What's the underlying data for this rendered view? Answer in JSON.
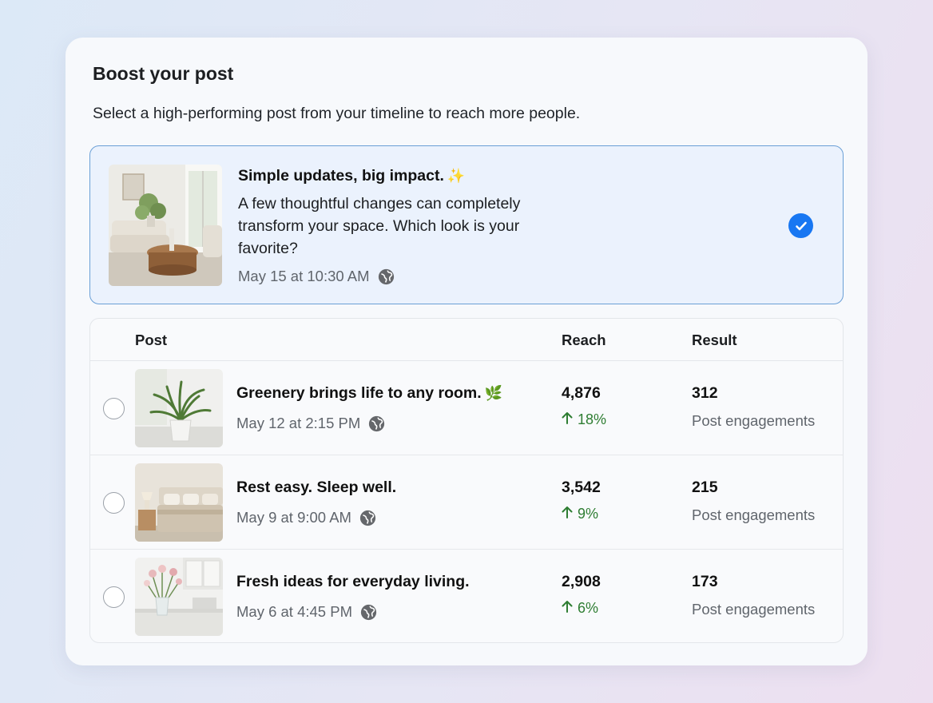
{
  "header": {
    "title": "Boost your post",
    "subtitle": "Select a high-performing post from your timeline to reach more people."
  },
  "selected_post": {
    "title": "Simple updates, big impact.",
    "title_emoji": "✨",
    "body": "A few thoughtful changes can completely transform your space. Which look is your favorite?",
    "date": "May 15 at 10:30 AM",
    "privacy_icon": "globe-icon",
    "selected": true
  },
  "table": {
    "columns": {
      "post": "Post",
      "reach": "Reach",
      "result": "Result"
    },
    "rows": [
      {
        "title": "Greenery brings life to any room.",
        "title_emoji": "🌿",
        "date": "May 12 at 2:15 PM",
        "reach": "4,876",
        "reach_change": "18%",
        "result": "312",
        "result_label": "Post engagements",
        "thumbnail": "fern-plant-photo"
      },
      {
        "title": "Rest easy. Sleep well.",
        "title_emoji": "",
        "date": "May 9 at 9:00 AM",
        "reach": "3,542",
        "reach_change": "9%",
        "result": "215",
        "result_label": "Post engagements",
        "thumbnail": "bedroom-photo"
      },
      {
        "title": "Fresh ideas for everyday living.",
        "title_emoji": "",
        "date": "May 6 at 4:45 PM",
        "reach": "2,908",
        "reach_change": "6%",
        "result": "173",
        "result_label": "Post engagements",
        "thumbnail": "kitchen-flowers-photo"
      }
    ]
  },
  "colors": {
    "accent": "#1877f2",
    "positive": "#2e7d32",
    "selected_bg": "#ebf2fd",
    "selected_border": "#6a9fd6"
  }
}
